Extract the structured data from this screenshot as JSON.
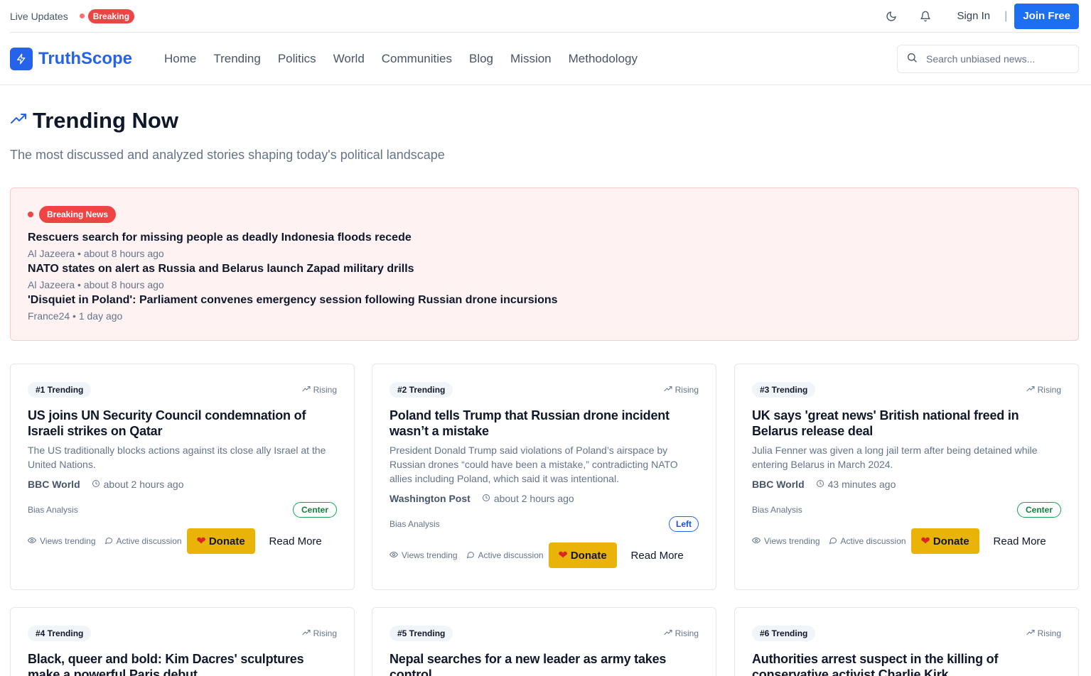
{
  "topbar": {
    "live_label": "Live Updates",
    "breaking_label": "Breaking",
    "signin_label": "Sign In",
    "separator": "|",
    "join_label": "Join Free"
  },
  "nav": {
    "logo_text": "TruthScope",
    "links": [
      "Home",
      "Trending",
      "Politics",
      "World",
      "Communities",
      "Blog",
      "Mission",
      "Methodology"
    ],
    "search_placeholder": "Search unbiased news..."
  },
  "page": {
    "title": "Trending Now",
    "subtitle": "The most discussed and analyzed stories shaping today's political landscape"
  },
  "breaking": {
    "label": "Breaking News",
    "items": [
      {
        "title": "Rescuers search for missing people as deadly Indonesia floods recede",
        "source": "Al Jazeera",
        "time": "about 8 hours ago"
      },
      {
        "title": "NATO states on alert as Russia and Belarus launch Zapad military drills",
        "source": "Al Jazeera",
        "time": "about 8 hours ago"
      },
      {
        "title": "'Disquiet in Poland': Parliament convenes emergency session following Russian drone incursions",
        "source": "France24",
        "time": "1 day ago"
      }
    ]
  },
  "cards_common": {
    "rising_label": "Rising",
    "bias_label": "Bias Analysis",
    "views_label": "Views trending",
    "discussion_label": "Active discussion",
    "donate_label": "Donate",
    "readmore_label": "Read More"
  },
  "cards": [
    {
      "rank": "#1 Trending",
      "title": "US joins UN Security Council condemnation of Israeli strikes on Qatar",
      "desc": "The US traditionally blocks actions against its close ally Israel at the United Nations.",
      "source": "BBC World",
      "time": "about 2 hours ago",
      "bias": "Center"
    },
    {
      "rank": "#2 Trending",
      "title": "Poland tells Trump that Russian drone incident wasn’t a mistake",
      "desc": "President Donald Trump said violations of Poland’s airspace by Russian drones “could have been a mistake,” contradicting NATO allies including Poland, which said it was intentional.",
      "source": "Washington Post",
      "time": "about 2 hours ago",
      "bias": "Left"
    },
    {
      "rank": "#3 Trending",
      "title": "UK says 'great news' British national freed in Belarus release deal",
      "desc": "Julia Fenner was given a long jail term after being detained while entering Belarus in March 2024.",
      "source": "BBC World",
      "time": "43 minutes ago",
      "bias": "Center"
    },
    {
      "rank": "#4 Trending",
      "title": "Black, queer and bold: Kim Dacres' sculptures make a powerful Paris debut"
    },
    {
      "rank": "#5 Trending",
      "title": "Nepal searches for a new leader as army takes control"
    },
    {
      "rank": "#6 Trending",
      "title": "Authorities arrest suspect in the killing of conservative activist Charlie Kirk"
    }
  ],
  "colors": {
    "brand": "#2563eb",
    "join_button": "#1d6ff2",
    "breaking_red": "#ef4444",
    "donate_yellow": "#eab308",
    "bias_center": "#16a34a",
    "bias_left": "#2563eb"
  }
}
